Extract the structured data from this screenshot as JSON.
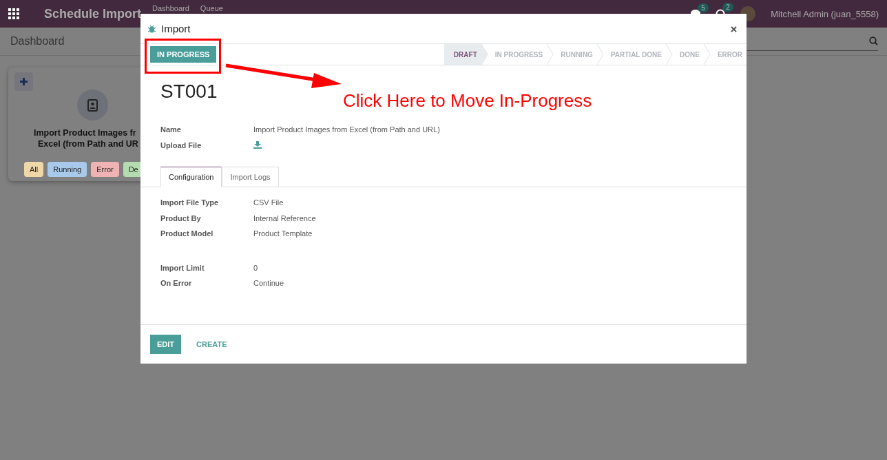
{
  "app_bar": {
    "title": "Schedule Import",
    "menu": [
      "Dashboard",
      "Queue"
    ],
    "chat_count": "5",
    "activity_count": "2",
    "user": "Mitchell Admin (juan_5558)"
  },
  "breadcrumb": "Dashboard",
  "card": {
    "title_lines": [
      "Import Product Images fr",
      "Excel (from Path and UR"
    ],
    "tags": [
      {
        "label": "All",
        "color": "#f0d7a8"
      },
      {
        "label": "Running",
        "color": "#a9c9ea"
      },
      {
        "label": "Error",
        "color": "#f0b3b3"
      },
      {
        "label": "De",
        "color": "#b5dcb0"
      }
    ]
  },
  "dialog": {
    "title": "Import",
    "action_button": "IN PROGRESS",
    "stages": [
      {
        "label": "DRAFT",
        "selected": true
      },
      {
        "label": "IN PROGRESS",
        "selected": false
      },
      {
        "label": "RUNNING",
        "selected": false
      },
      {
        "label": "PARTIAL DONE",
        "selected": false
      },
      {
        "label": "DONE",
        "selected": false
      },
      {
        "label": "ERROR",
        "selected": false
      }
    ],
    "record": "ST001",
    "fields": [
      {
        "label": "Name",
        "value": "Import Product Images from Excel (from Path and URL)",
        "kind": "text"
      },
      {
        "label": "Upload File",
        "kind": "download"
      }
    ],
    "tabs": [
      {
        "label": "Configuration",
        "selected": true
      },
      {
        "label": "Import Logs",
        "selected": false
      }
    ],
    "config": [
      {
        "label": "Import File Type",
        "value": "CSV File"
      },
      {
        "label": "Product By",
        "value": "Internal Reference"
      },
      {
        "label": "Product Model",
        "value": "Product Template"
      }
    ],
    "config_2": [
      {
        "label": "Import Limit",
        "value": "0"
      },
      {
        "label": "On Error",
        "value": "Continue"
      }
    ],
    "footer_buttons": [
      {
        "label": "EDIT",
        "kind": "primary"
      },
      {
        "label": "CREATE",
        "kind": "link"
      }
    ]
  },
  "annotation": "Click Here to Move In-Progress"
}
